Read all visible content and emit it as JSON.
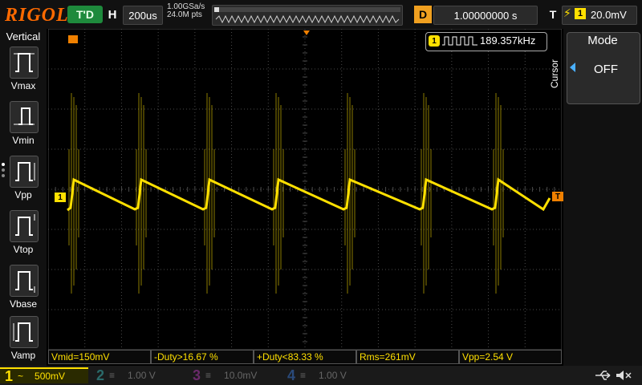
{
  "top": {
    "brand": "RIGOL",
    "run_status": "T'D",
    "timebase_label": "H",
    "timebase": "200us",
    "sample_rate": "1.00GSa/s",
    "memory_depth": "24.0M pts",
    "delay_label": "D",
    "delay": "1.00000000 s",
    "trigger_label": "T",
    "trigger_channel": "1",
    "trigger_level": "20.0mV"
  },
  "left": {
    "title": "Vertical",
    "buttons": [
      {
        "label": "Vmax"
      },
      {
        "label": "Vmin"
      },
      {
        "label": "Vpp"
      },
      {
        "label": "Vtop"
      },
      {
        "label": "Vbase"
      },
      {
        "label": "Vamp"
      }
    ]
  },
  "display": {
    "freq_channel": "1",
    "frequency": "189.357kHz",
    "ch1_marker": "1",
    "trigger_marker": "T",
    "trace_color": "#ffe000",
    "grid_color": "#4a4a4a"
  },
  "right": {
    "section_label": "Cursor",
    "mode_title": "Mode",
    "mode_value": "OFF"
  },
  "measurements": [
    "Vmid=150mV",
    "-Duty>16.67 %",
    "+Duty<83.33 %",
    "Rms=261mV",
    "Vpp=2.54 V"
  ],
  "channels": [
    {
      "num": "1",
      "coupling": "~",
      "scale": "500mV",
      "color": "#ffe000"
    },
    {
      "num": "2",
      "coupling": "≡",
      "scale": "1.00 V",
      "color": "#00c0c0"
    },
    {
      "num": "3",
      "coupling": "≡",
      "scale": "10.0mV",
      "color": "#c040c0"
    },
    {
      "num": "4",
      "coupling": "≡",
      "scale": "1.00 V",
      "color": "#4080ff"
    }
  ]
}
